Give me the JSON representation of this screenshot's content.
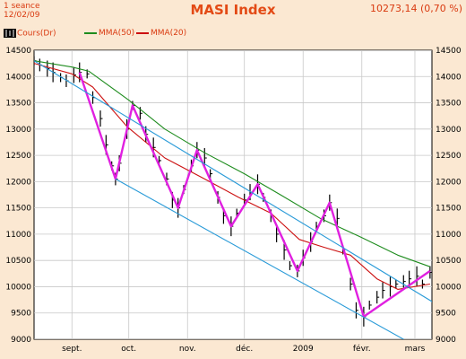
{
  "header": {
    "period": "1 seance",
    "date": "12/02/09",
    "title": "MASI Index",
    "last_value": "10273,14  (0,70 %)"
  },
  "legend": [
    {
      "label": "Cours(Dr)",
      "color": "#000000"
    },
    {
      "label": "MMA(50)",
      "color": "#1e8c1e"
    },
    {
      "label": "MMA(20)",
      "color": "#cc1010"
    }
  ],
  "colors": {
    "background": "#fbe8d2",
    "plot_bg": "#ffffff",
    "grid": "#c8c8c8",
    "channel": "#2a9bd8",
    "zigzag": "#e020e0",
    "text": "#d93a10"
  },
  "chart_data": {
    "type": "line",
    "title": "MASI Index",
    "ylim": [
      9000,
      14500
    ],
    "y_ticks": [
      9000,
      9500,
      10000,
      10500,
      11000,
      11500,
      12000,
      12500,
      13000,
      13500,
      14000,
      14500
    ],
    "y_tick_labels": [
      "9000",
      "9500",
      "10000",
      "10500",
      "11000",
      "11500",
      "12000",
      "12500",
      "13000",
      "13500",
      "14000",
      "14500"
    ],
    "x_start": "2008-08-12",
    "x_end": "2009-03-10",
    "x_ticks": [
      {
        "date": "2008-09-01",
        "label": "sept."
      },
      {
        "date": "2008-10-01",
        "label": "oct."
      },
      {
        "date": "2008-11-01",
        "label": "nov."
      },
      {
        "date": "2008-12-01",
        "label": "déc."
      },
      {
        "date": "2009-01-01",
        "label": "2009"
      },
      {
        "date": "2009-02-01",
        "label": "févr."
      },
      {
        "date": "2009-03-01",
        "label": "mars"
      }
    ],
    "grid": true,
    "series": [
      {
        "name": "Cours(Dr)",
        "style": "bars",
        "points": [
          [
            "2008-08-12",
            14300
          ],
          [
            "2008-08-15",
            14220
          ],
          [
            "2008-08-19",
            14150
          ],
          [
            "2008-08-22",
            14080
          ],
          [
            "2008-08-26",
            13980
          ],
          [
            "2008-08-29",
            13920
          ],
          [
            "2008-09-02",
            14030
          ],
          [
            "2008-09-05",
            14080
          ],
          [
            "2008-09-09",
            14050
          ],
          [
            "2008-09-12",
            13600
          ],
          [
            "2008-09-16",
            13200
          ],
          [
            "2008-09-19",
            12700
          ],
          [
            "2008-09-22",
            12300
          ],
          [
            "2008-09-24",
            12050
          ],
          [
            "2008-09-26",
            12350
          ],
          [
            "2008-09-30",
            13000
          ],
          [
            "2008-10-03",
            13450
          ],
          [
            "2008-10-07",
            13300
          ],
          [
            "2008-10-10",
            12900
          ],
          [
            "2008-10-14",
            12650
          ],
          [
            "2008-10-17",
            12400
          ],
          [
            "2008-10-21",
            12050
          ],
          [
            "2008-10-24",
            11650
          ],
          [
            "2008-10-27",
            11500
          ],
          [
            "2008-10-30",
            11850
          ],
          [
            "2008-11-03",
            12300
          ],
          [
            "2008-11-06",
            12600
          ],
          [
            "2008-11-10",
            12450
          ],
          [
            "2008-11-13",
            12150
          ],
          [
            "2008-11-17",
            11700
          ],
          [
            "2008-11-20",
            11350
          ],
          [
            "2008-11-24",
            11150
          ],
          [
            "2008-11-27",
            11400
          ],
          [
            "2008-12-01",
            11650
          ],
          [
            "2008-12-04",
            11800
          ],
          [
            "2008-12-08",
            11950
          ],
          [
            "2008-12-11",
            11700
          ],
          [
            "2008-12-15",
            11350
          ],
          [
            "2008-12-18",
            11000
          ],
          [
            "2008-12-22",
            10700
          ],
          [
            "2008-12-25",
            10400
          ],
          [
            "2008-12-29",
            10300
          ],
          [
            "2009-01-01",
            10550
          ],
          [
            "2009-01-05",
            10850
          ],
          [
            "2009-01-08",
            11150
          ],
          [
            "2009-01-12",
            11350
          ],
          [
            "2009-01-15",
            11600
          ],
          [
            "2009-01-19",
            11300
          ],
          [
            "2009-01-22",
            10700
          ],
          [
            "2009-01-26",
            10050
          ],
          [
            "2009-01-29",
            9550
          ],
          [
            "2009-02-02",
            9430
          ],
          [
            "2009-02-05",
            9650
          ],
          [
            "2009-02-09",
            9800
          ],
          [
            "2009-02-12",
            9930
          ],
          [
            "2009-02-16",
            10000
          ],
          [
            "2009-02-19",
            10050
          ],
          [
            "2009-02-23",
            10100
          ],
          [
            "2009-02-26",
            10150
          ],
          [
            "2009-03-02",
            10200
          ],
          [
            "2009-03-05",
            10050
          ],
          [
            "2009-03-09",
            10273
          ]
        ]
      },
      {
        "name": "MMA(50)",
        "style": "line",
        "color": "#1e8c1e",
        "points": [
          [
            "2008-08-12",
            14300
          ],
          [
            "2008-09-01",
            14180
          ],
          [
            "2008-09-10",
            14100
          ],
          [
            "2008-10-01",
            13550
          ],
          [
            "2008-10-20",
            13000
          ],
          [
            "2008-11-10",
            12550
          ],
          [
            "2008-12-01",
            12150
          ],
          [
            "2008-12-20",
            11750
          ],
          [
            "2009-01-10",
            11300
          ],
          [
            "2009-01-31",
            10950
          ],
          [
            "2009-02-20",
            10600
          ],
          [
            "2009-03-09",
            10380
          ]
        ]
      },
      {
        "name": "MMA(20)",
        "style": "line",
        "color": "#cc1010",
        "points": [
          [
            "2008-08-12",
            14250
          ],
          [
            "2008-09-01",
            14050
          ],
          [
            "2008-09-12",
            13800
          ],
          [
            "2008-09-30",
            13050
          ],
          [
            "2008-10-20",
            12450
          ],
          [
            "2008-11-10",
            12050
          ],
          [
            "2008-11-28",
            11700
          ],
          [
            "2008-12-15",
            11400
          ],
          [
            "2008-12-30",
            10900
          ],
          [
            "2009-01-12",
            10750
          ],
          [
            "2009-01-26",
            10600
          ],
          [
            "2009-02-09",
            10150
          ],
          [
            "2009-02-20",
            9950
          ],
          [
            "2009-03-09",
            10050
          ]
        ]
      },
      {
        "name": "Zigzag",
        "style": "line",
        "color": "#e020e0",
        "points": [
          [
            "2008-09-05",
            14080
          ],
          [
            "2008-09-24",
            12050
          ],
          [
            "2008-10-03",
            13450
          ],
          [
            "2008-10-27",
            11500
          ],
          [
            "2008-11-06",
            12600
          ],
          [
            "2008-11-24",
            11150
          ],
          [
            "2008-12-08",
            11950
          ],
          [
            "2008-12-29",
            10300
          ],
          [
            "2009-01-15",
            11600
          ],
          [
            "2009-02-02",
            9430
          ],
          [
            "2009-03-09",
            10300
          ]
        ]
      },
      {
        "name": "Upper channel",
        "style": "line",
        "color": "#2a9bd8",
        "points": [
          [
            "2008-08-12",
            14300
          ],
          [
            "2009-03-20",
            9500
          ]
        ]
      },
      {
        "name": "Lower channel",
        "style": "line",
        "color": "#2a9bd8",
        "points": [
          [
            "2008-09-24",
            12050
          ],
          [
            "2009-02-28",
            8900
          ]
        ]
      }
    ]
  }
}
